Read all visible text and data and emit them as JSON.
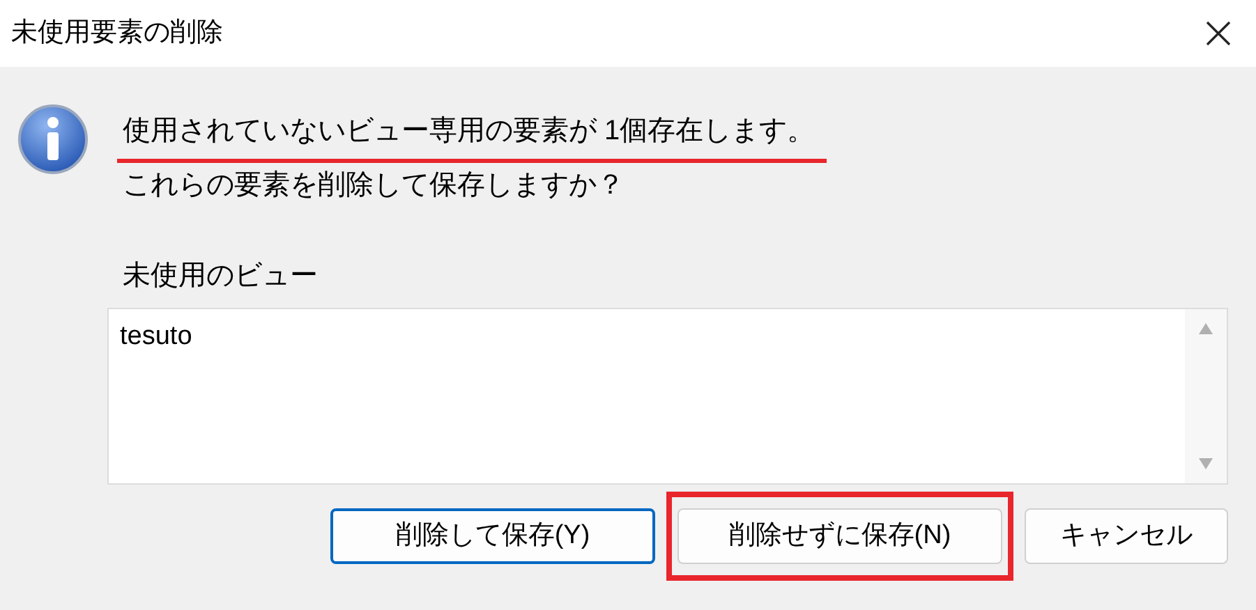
{
  "window": {
    "title": "未使用要素の削除"
  },
  "message": {
    "lines": [
      {
        "text": "使用されていないビュー専用の要素が 1個存在します。",
        "underlined": true
      },
      {
        "text": "これらの要素を削除して保存しますか？",
        "underlined": false
      }
    ]
  },
  "list": {
    "label": "未使用のビュー",
    "items": [
      "tesuto"
    ]
  },
  "buttons": [
    {
      "label": "削除して保存(Y)",
      "default": true,
      "highlighted": false
    },
    {
      "label": "削除せずに保存(N)",
      "default": false,
      "highlighted": true
    },
    {
      "label": "キャンセル",
      "default": false,
      "highlighted": false
    }
  ]
}
